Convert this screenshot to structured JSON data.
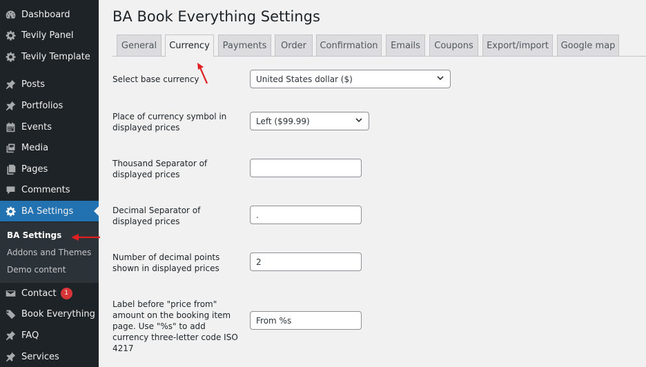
{
  "sidebar": {
    "items": [
      {
        "label": "Dashboard",
        "icon": "dashboard-icon"
      },
      {
        "label": "Tevily Panel",
        "icon": "gear-icon"
      },
      {
        "label": "Tevily Template",
        "icon": "gear-icon"
      },
      {
        "label": "Posts",
        "icon": "pin-icon"
      },
      {
        "label": "Portfolios",
        "icon": "pin-icon"
      },
      {
        "label": "Events",
        "icon": "calendar-icon"
      },
      {
        "label": "Media",
        "icon": "media-icon"
      },
      {
        "label": "Pages",
        "icon": "pages-icon"
      },
      {
        "label": "Comments",
        "icon": "comment-icon"
      },
      {
        "label": "BA Settings",
        "icon": "gear-icon"
      },
      {
        "label": "Contact",
        "icon": "mail-icon"
      },
      {
        "label": "Book Everything",
        "icon": "tag-icon"
      },
      {
        "label": "FAQ",
        "icon": "pin-icon"
      },
      {
        "label": "Services",
        "icon": "pin-icon"
      }
    ],
    "submenu": [
      "BA Settings",
      "Addons and Themes",
      "Demo content"
    ],
    "contact_badge": "1"
  },
  "page": {
    "title": "BA Book Everything Settings",
    "tabs": [
      "General",
      "Currency",
      "Payments",
      "Order",
      "Confirmation",
      "Emails",
      "Coupons",
      "Export/import",
      "Google map"
    ],
    "active_tab": "Currency"
  },
  "settings": {
    "base_currency": {
      "label": "Select base currency",
      "value": "United States dollar ($)"
    },
    "symbol_place": {
      "label": "Place of currency symbol in displayed prices",
      "value": "Left ($99.99)"
    },
    "thousand_sep": {
      "label": "Thousand Separator of displayed prices",
      "value": ""
    },
    "decimal_sep": {
      "label": "Decimal Separator of displayed prices",
      "value": "."
    },
    "decimal_points": {
      "label": "Number of decimal points shown in displayed prices",
      "value": "2"
    },
    "price_from_label": {
      "label": "Label before \"price from\" amount on the booking item page. Use \"%s\" to add currency three-letter code ISO 4217",
      "value": "From %s"
    }
  },
  "colors": {
    "sidebar_bg": "#1d2327",
    "active_menu": "#2271b1",
    "annotation_arrow": "#e02020"
  }
}
